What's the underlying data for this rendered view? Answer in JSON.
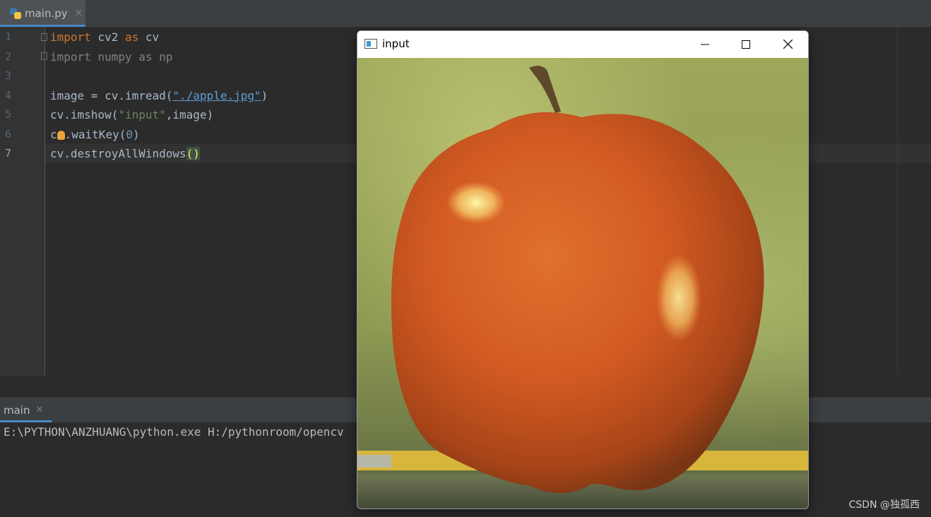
{
  "editor": {
    "tab": {
      "label": "main.py"
    },
    "line_numbers": [
      "1",
      "2",
      "3",
      "4",
      "5",
      "6",
      "7"
    ],
    "code": {
      "l1": {
        "kw1": "import",
        "mod": " cv2 ",
        "kw2": "as",
        "alias": " cv"
      },
      "l2": {
        "text": "import numpy as np"
      },
      "l4": {
        "pre": "image = cv.imread(",
        "str": "\"./apple.jpg\"",
        "post": ")"
      },
      "l5": {
        "pre": "cv.imshow(",
        "str": "\"input\"",
        "mid": ",",
        "post": "image)"
      },
      "l6": {
        "pre": "c",
        "post": ".waitKey(",
        "num": "0",
        "end": ")"
      },
      "l7": {
        "pre": "cv.destroyAllWindows",
        "parens": "()"
      }
    }
  },
  "run_panel": {
    "tab_label": "main",
    "console_line": "E:\\PYTHON\\ANZHUANG\\python.exe H:/pythonroom/opencv"
  },
  "image_window": {
    "title": "input",
    "image_subject": "red apple on green background"
  },
  "watermark": "CSDN @独孤西",
  "colors": {
    "keyword": "#cc7832",
    "string": "#6a8759",
    "number": "#6897bb",
    "accent": "#4a88c7"
  }
}
